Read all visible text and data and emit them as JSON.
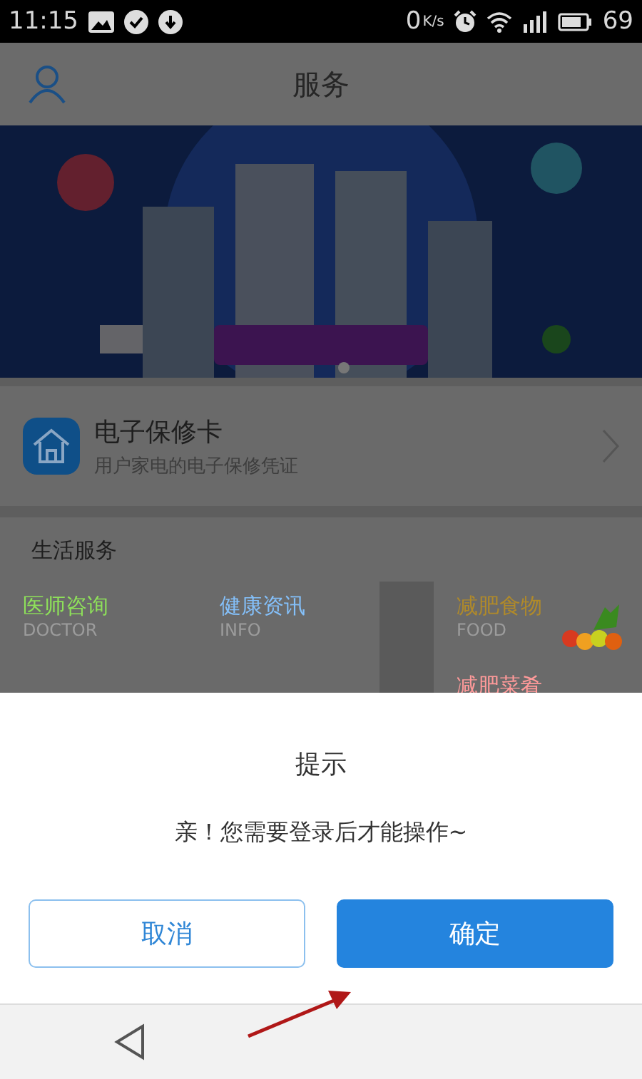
{
  "status_bar": {
    "time": "11:15",
    "speed": "0",
    "speed_unit": "K/s",
    "battery": "69"
  },
  "header": {
    "title": "服务"
  },
  "warranty_card": {
    "title": "电子保修卡",
    "subtitle": "用户家电的电子保修凭证"
  },
  "life_services": {
    "title": "生活服务",
    "items": [
      {
        "name": "医师咨询",
        "english": "DOCTOR",
        "color": "#8ee05a",
        "kind": "plain"
      },
      {
        "name": "健康资讯",
        "english": "INFO",
        "color": "#84c0fa",
        "kind": "plain"
      },
      {
        "name": "减肥食物",
        "english": "FOOD",
        "color": "#b08a2a",
        "kind": "fruit"
      },
      {
        "name": "减肥菜肴",
        "color": "#ff9a9a",
        "kind": "plain"
      }
    ]
  },
  "dialog": {
    "title": "提示",
    "message": "亲！您需要登录后才能操作~",
    "buttons": [
      {
        "label": "取消",
        "kind": "outline"
      },
      {
        "label": "确定",
        "kind": "primary"
      }
    ]
  }
}
